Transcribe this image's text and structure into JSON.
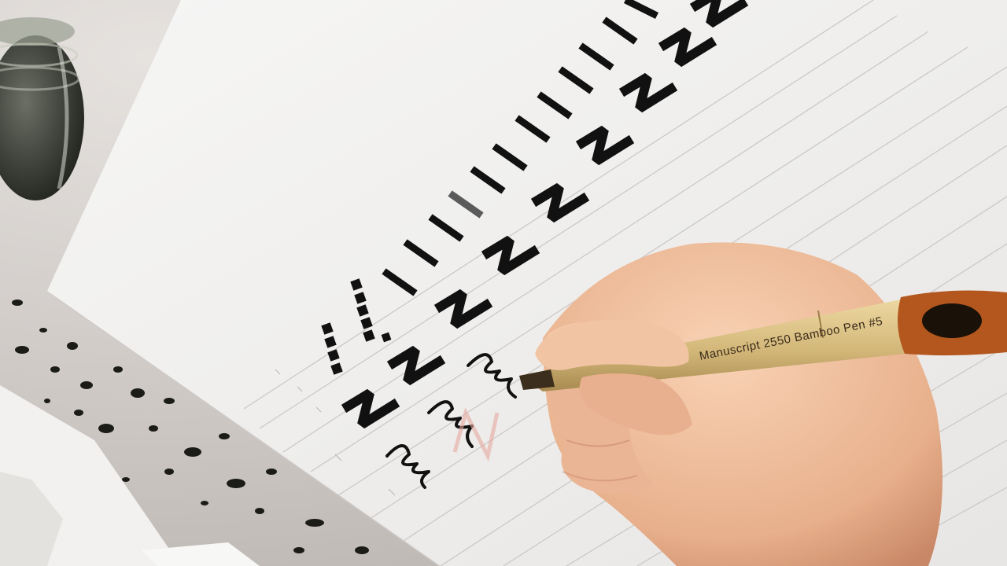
{
  "scene": {
    "subject": "calligraphy-practice",
    "pen_imprint": "Manuscript 2550 Bamboo Pen #5",
    "colors": {
      "table": "#cfc9c6",
      "paper": "#f3f2f0",
      "ink": "#111111",
      "guideline": "#c9c7c4",
      "bamboo": "#d8c08a",
      "skin": "#efbf9a"
    }
  }
}
